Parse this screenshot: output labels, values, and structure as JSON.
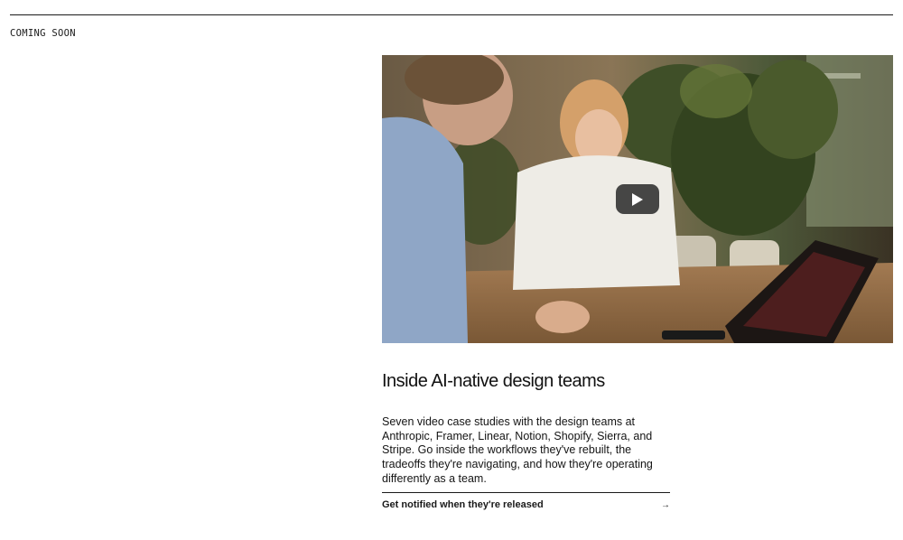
{
  "header": {
    "eyebrow": "COMING SOON"
  },
  "video": {
    "play_icon": "play-icon",
    "play_button_color": "#212121"
  },
  "feature": {
    "title": "Inside AI-native design teams",
    "description": "Seven video case studies with the design teams at Anthropic, Framer, Linear, Notion, Shopify, Sierra, and Stripe. Go inside the workflows they've rebuilt, the tradeoffs they're navigating, and how they're operating differently as a team.",
    "cta_label": "Get notified when they're released",
    "cta_arrow": "→"
  }
}
